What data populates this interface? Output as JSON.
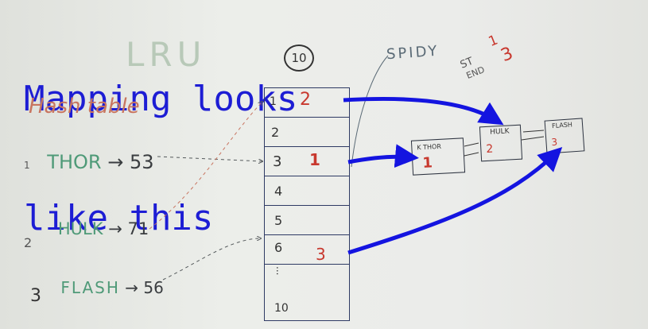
{
  "title": {
    "line1": "Mapping looks",
    "line2": "like this"
  },
  "ghost_text": "LRU",
  "circled_number": "10",
  "hash_table_label": "Hash table",
  "map_entries": [
    {
      "index": "1",
      "name": "THOR",
      "arrow": "→",
      "value": "53"
    },
    {
      "index": "2",
      "name": "HULK",
      "arrow": "→",
      "value": "71"
    },
    {
      "index": "3",
      "name": "FLASH",
      "arrow": "→",
      "value": "56"
    }
  ],
  "table_slots": [
    {
      "index": "1",
      "content": "2"
    },
    {
      "index": "2",
      "content": ""
    },
    {
      "index": "3",
      "content": "1"
    },
    {
      "index": "4",
      "content": ""
    },
    {
      "index": "5",
      "content": ""
    },
    {
      "index": "6",
      "content": "3"
    },
    {
      "index": "...",
      "content": ""
    },
    {
      "index": "10",
      "content": ""
    }
  ],
  "spidy_label": "SPIDY",
  "notes": {
    "st": "ST",
    "st_value": "1",
    "end": "END",
    "end_value": "3"
  },
  "nodes": [
    {
      "label": "K THOR",
      "value": "1"
    },
    {
      "label": "HULK",
      "value": "2"
    },
    {
      "label": "FLASH",
      "value": "3"
    }
  ],
  "colors": {
    "title": "#1d1dd4",
    "arrow": "#1414e0",
    "red": "#c8382e",
    "green": "#4f9a78",
    "pencil": "#555a5c"
  }
}
